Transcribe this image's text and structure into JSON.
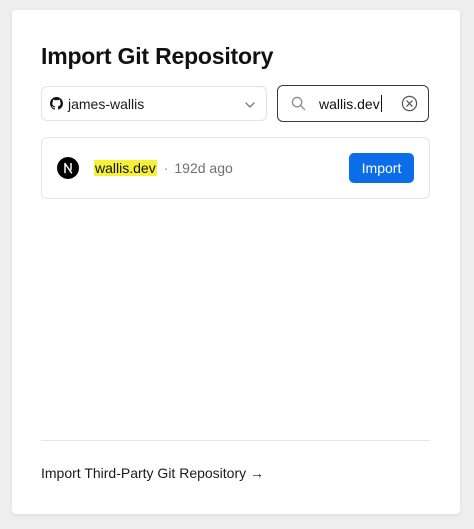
{
  "page": {
    "title": "Import Git Repository"
  },
  "scope": {
    "provider_icon": "github-icon",
    "account": "james-wallis"
  },
  "search": {
    "value": "wallis.dev"
  },
  "repositories": [
    {
      "name": "wallis.dev",
      "separator": "·",
      "updated": "192d ago",
      "avatar_icon": "nextjs-icon",
      "action_label": "Import"
    }
  ],
  "footer": {
    "third_party_label": "Import Third-Party Git Repository →"
  },
  "colors": {
    "accent": "#0b6ee8",
    "highlight": "#f5f03a"
  }
}
